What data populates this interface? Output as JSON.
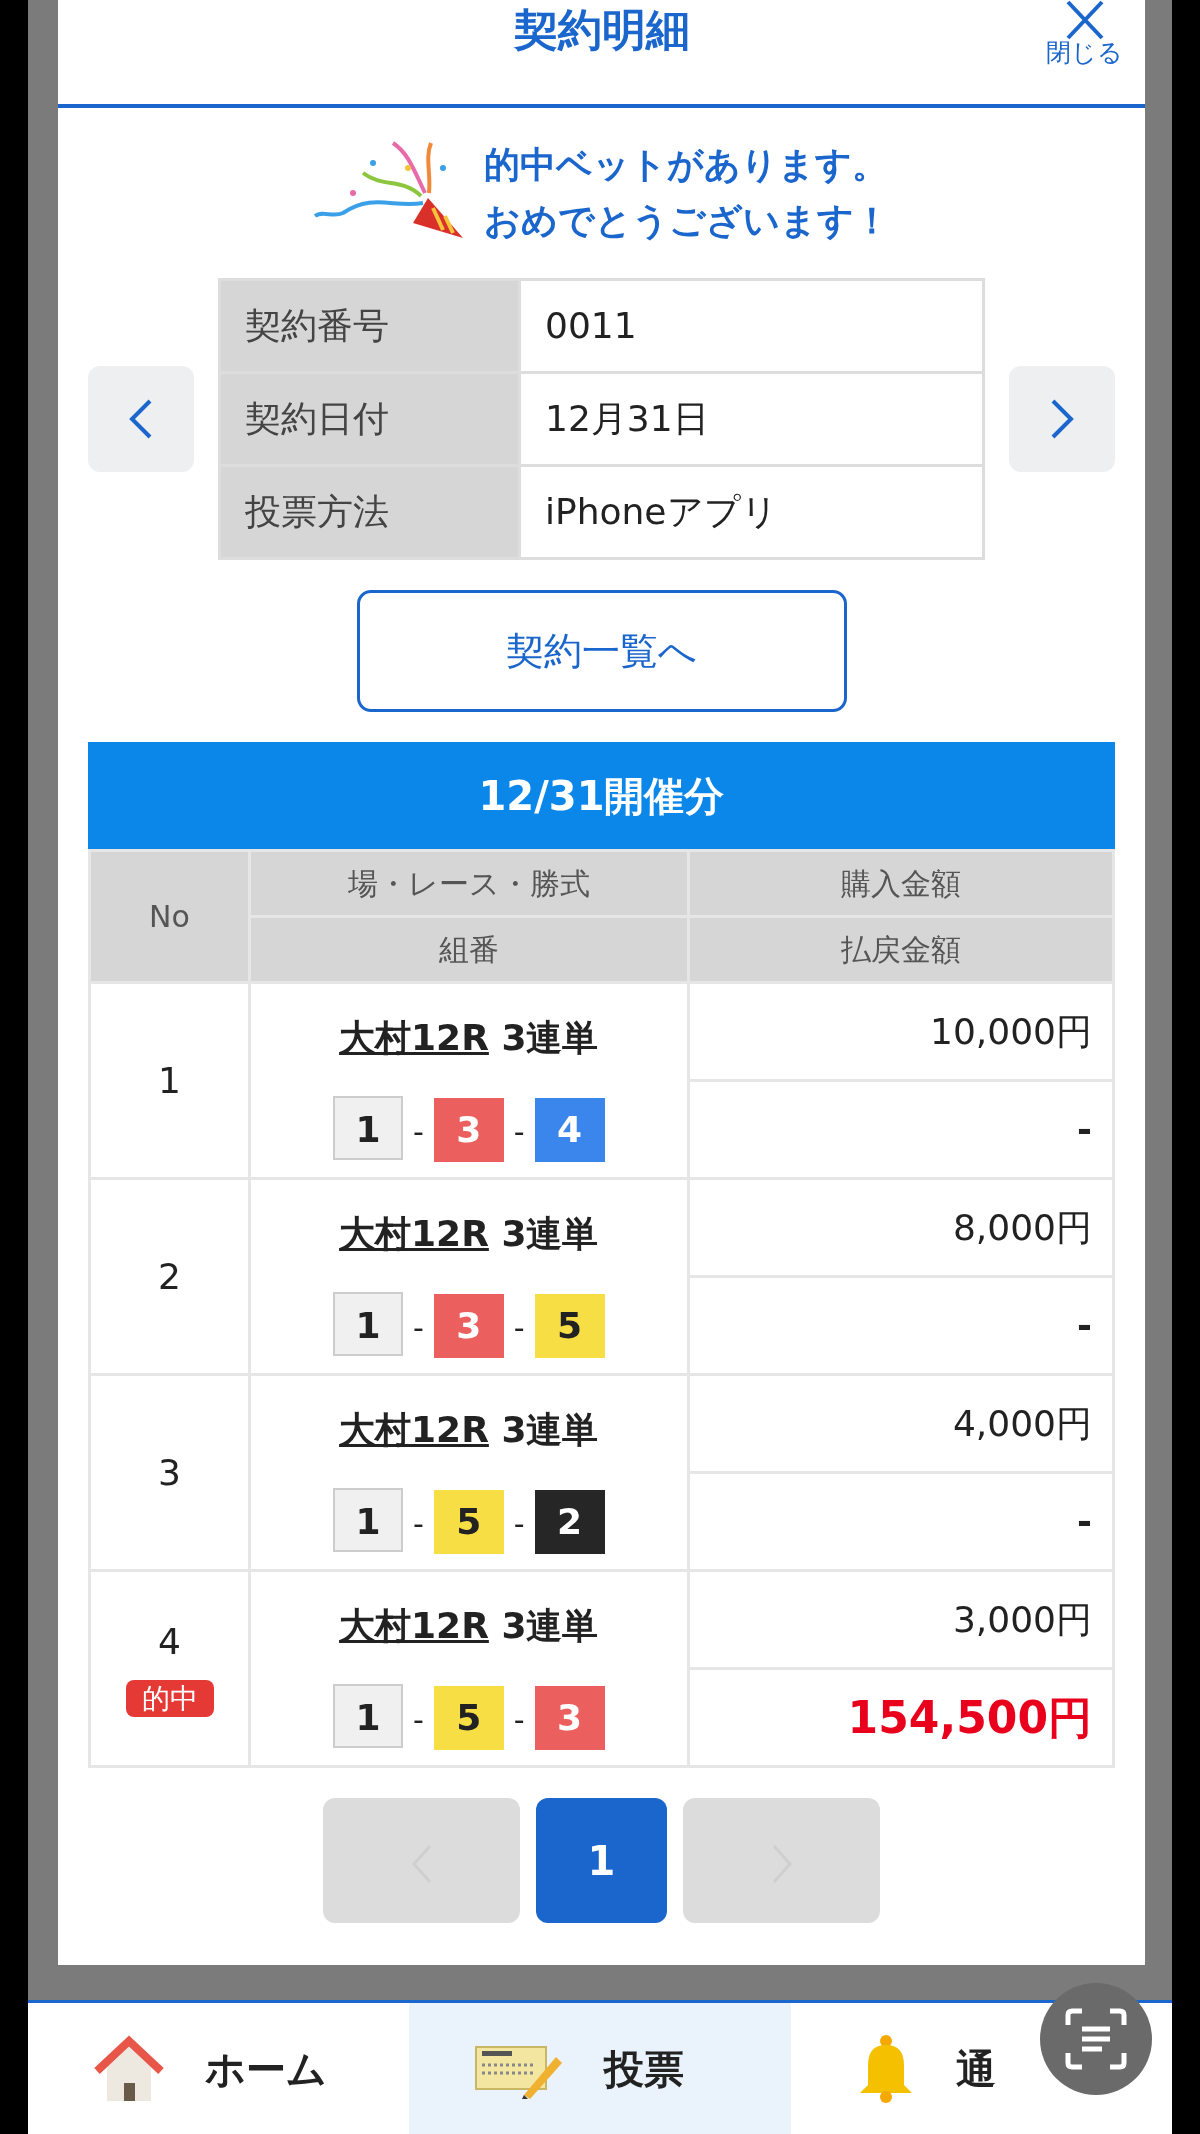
{
  "modal": {
    "title": "契約明細",
    "close_label": "閉じる"
  },
  "congrats": [
    "的中ベットがあります。",
    "おめでとうございます！"
  ],
  "contract": [
    {
      "label": "契約番号",
      "value": "0011"
    },
    {
      "label": "契約日付",
      "value": "12月31日"
    },
    {
      "label": "投票方法",
      "value": "iPhoneアプリ"
    }
  ],
  "list_button": "契約一覧へ",
  "session_title": "12/31開催分",
  "table": {
    "columns": {
      "no": "No",
      "race": "場・レース・勝式",
      "combo": "組番",
      "stake": "購入金額",
      "payout": "払戻金額"
    },
    "rows": [
      {
        "no": "1",
        "venue": "大村12R",
        "bet_type": "3連単",
        "separators": [
          "-",
          "-"
        ],
        "boats": [
          {
            "number": "1",
            "color": "#f0f0f0"
          },
          {
            "number": "3",
            "color": "#ec5f5f"
          },
          {
            "number": "4",
            "color": "#3b86ec"
          }
        ],
        "stake": "10,000円",
        "payout": "-",
        "hit": false
      },
      {
        "no": "2",
        "venue": "大村12R",
        "bet_type": "3連単",
        "separators": [
          "-",
          "-"
        ],
        "boats": [
          {
            "number": "1",
            "color": "#f0f0f0"
          },
          {
            "number": "3",
            "color": "#ec5f5f"
          },
          {
            "number": "5",
            "color": "#f7de45"
          }
        ],
        "stake": "8,000円",
        "payout": "-",
        "hit": false
      },
      {
        "no": "3",
        "venue": "大村12R",
        "bet_type": "3連単",
        "separators": [
          "-",
          "-"
        ],
        "boats": [
          {
            "number": "1",
            "color": "#f0f0f0"
          },
          {
            "number": "5",
            "color": "#f7de45"
          },
          {
            "number": "2",
            "color": "#262626"
          }
        ],
        "stake": "4,000円",
        "payout": "-",
        "hit": false
      },
      {
        "no": "4",
        "venue": "大村12R",
        "bet_type": "3連単",
        "separators": [
          "-",
          "-"
        ],
        "boats": [
          {
            "number": "1",
            "color": "#f0f0f0"
          },
          {
            "number": "5",
            "color": "#f7de45"
          },
          {
            "number": "3",
            "color": "#ec5f5f"
          }
        ],
        "stake": "3,000円",
        "payout": "154,500円",
        "hit": true,
        "hit_badge": "的中"
      }
    ]
  },
  "pagination": {
    "prev_disabled": true,
    "next_disabled": true,
    "pages": [
      {
        "label": "1",
        "selected": true
      }
    ]
  },
  "bottom_nav": [
    {
      "kind": "home",
      "label": "ホーム",
      "selected": false
    },
    {
      "kind": "vote",
      "label": "投票",
      "selected": true
    },
    {
      "kind": "notice",
      "label": "通",
      "selected": false
    }
  ]
}
